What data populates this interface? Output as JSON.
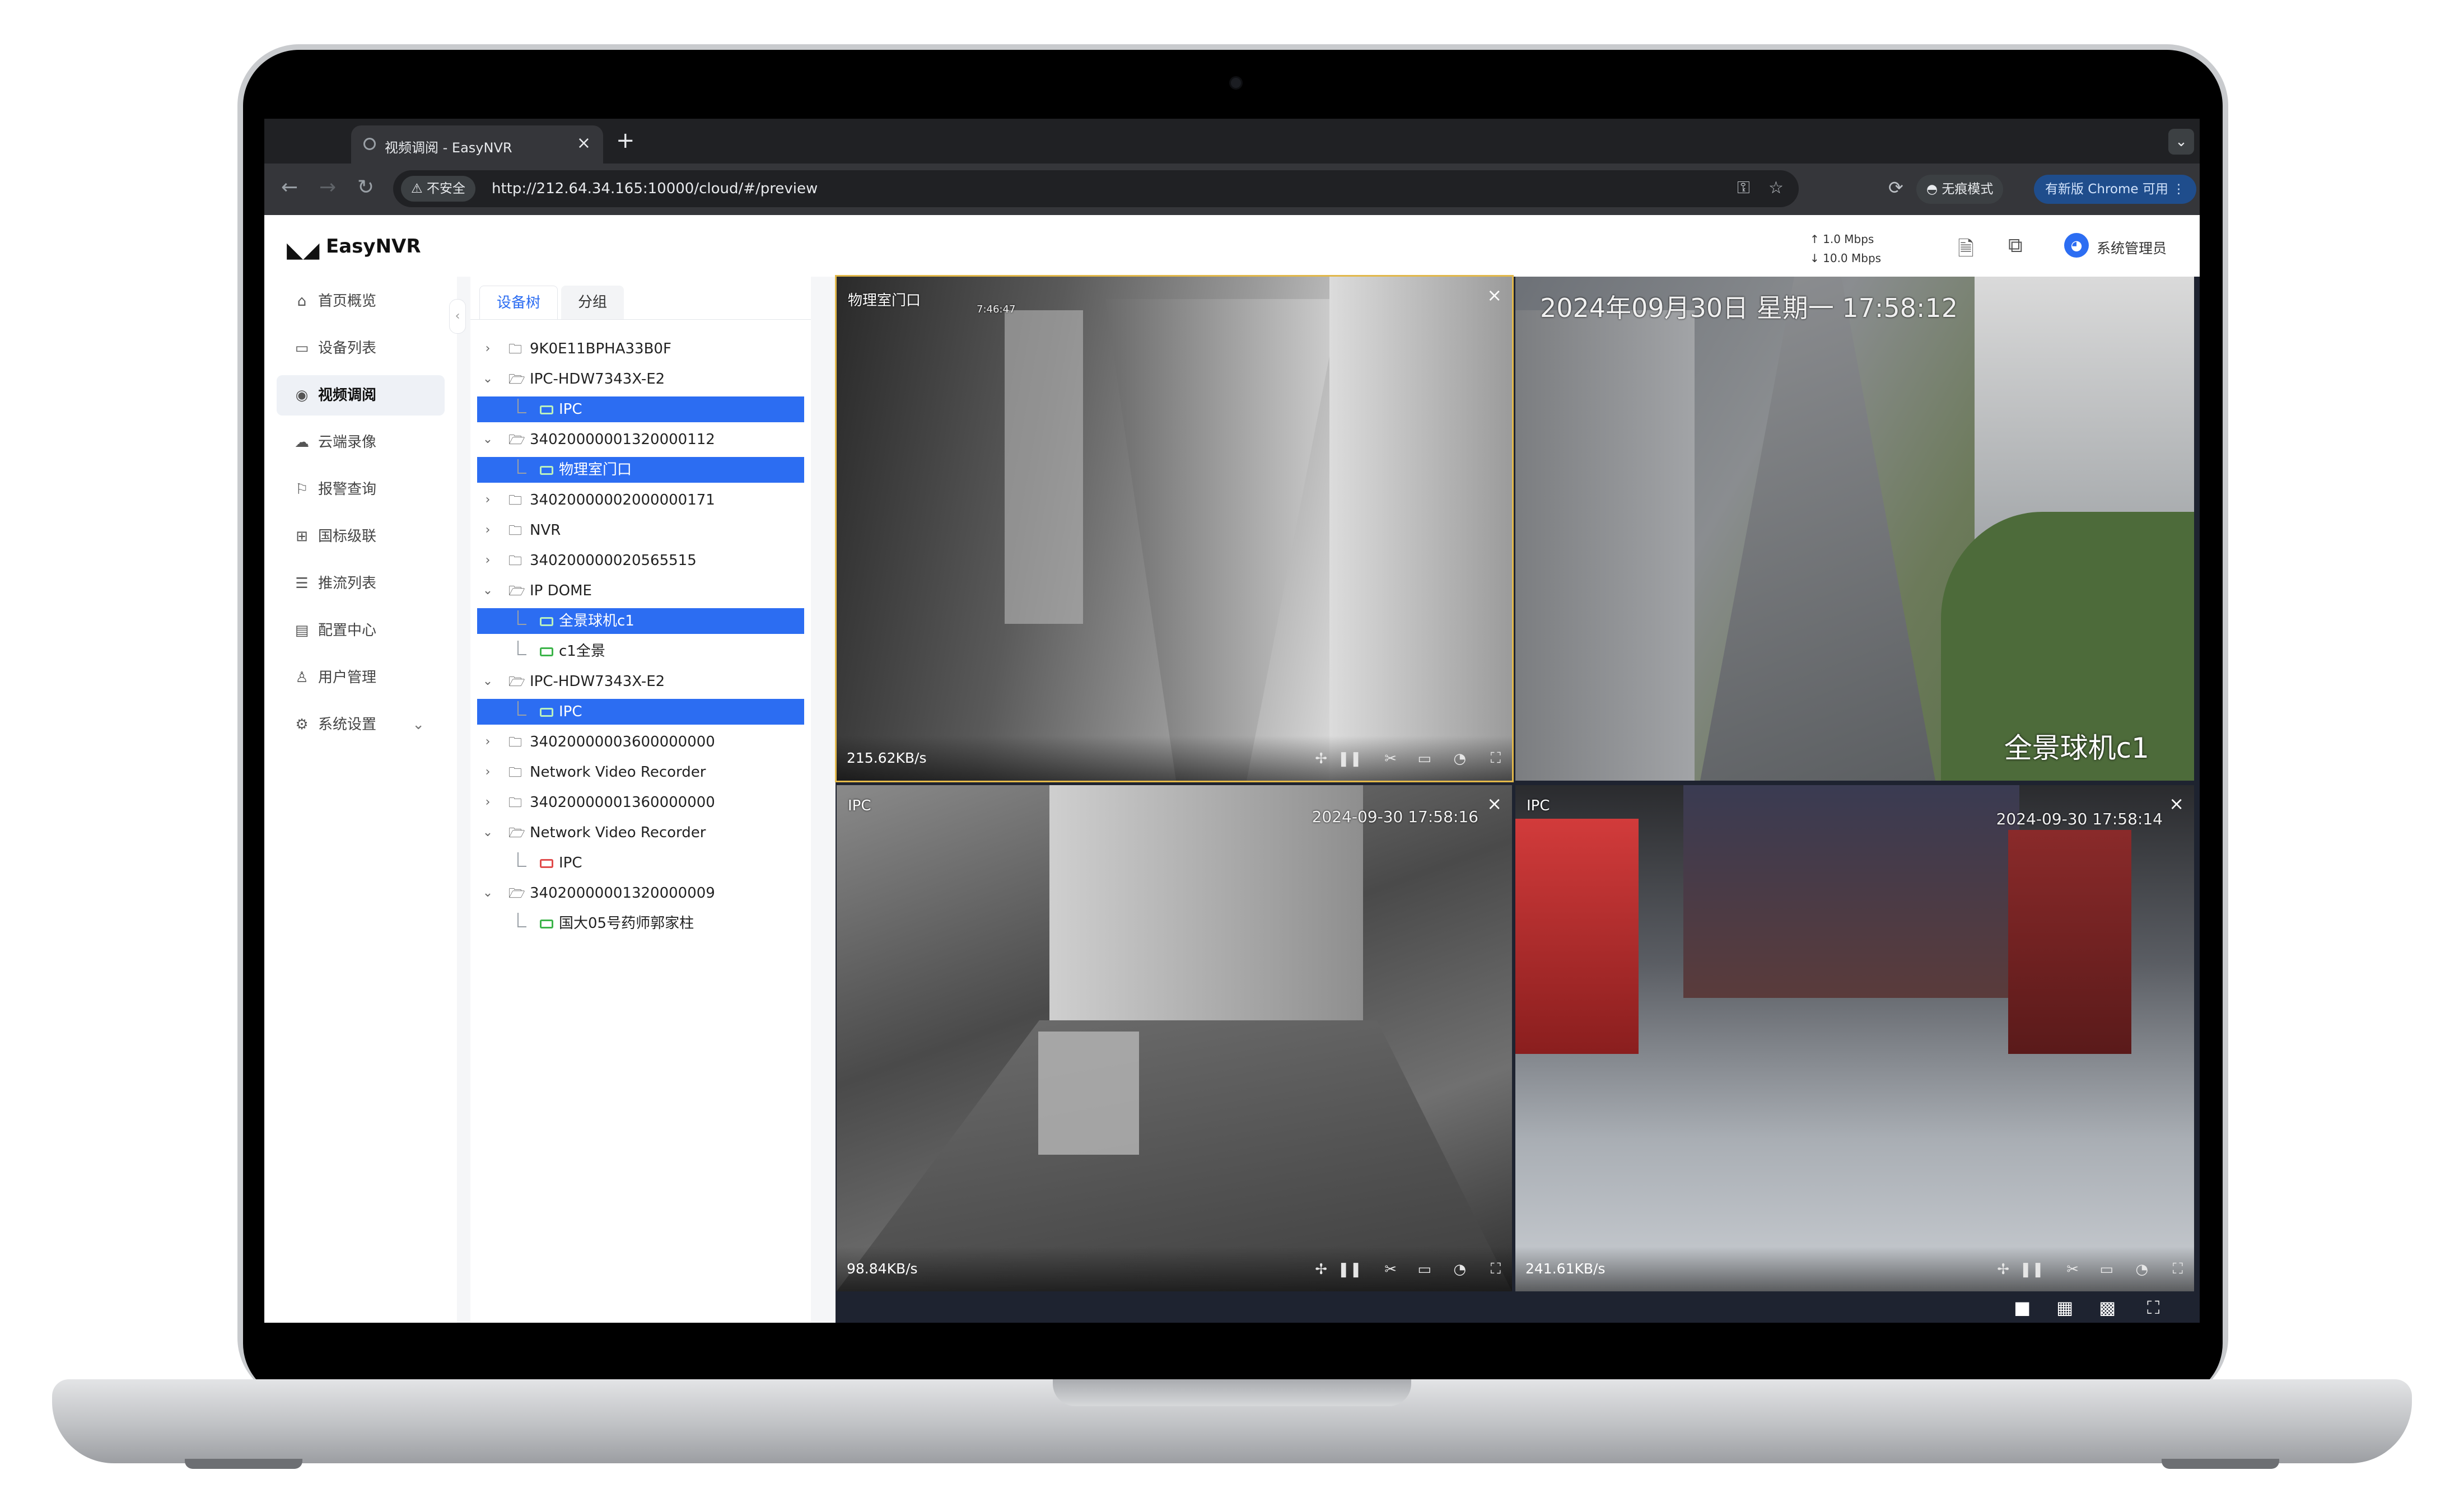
{
  "browser": {
    "tab_title": "视频调阅 - EasyNVR",
    "tab_close": "×",
    "new_tab": "+",
    "tab_menu": "⌄",
    "back": "←",
    "forward": "→",
    "reload": "↻",
    "security_label": "⚠ 不安全",
    "url": "http://212.64.34.165:10000/cloud/#/preview",
    "incognito_label": "无痕模式",
    "update_label": "有新版 Chrome 可用"
  },
  "app": {
    "brand": "EasyNVR",
    "upload_rate": "↑ 1.0 Mbps",
    "download_rate": "↓ 10.0 Mbps",
    "user_name": "系统管理员"
  },
  "sidebar": {
    "items": [
      {
        "label": "首页概览",
        "icon": "⌂"
      },
      {
        "label": "设备列表",
        "icon": "▭"
      },
      {
        "label": "视频调阅",
        "icon": "◉"
      },
      {
        "label": "云端录像",
        "icon": "☁"
      },
      {
        "label": "报警查询",
        "icon": "⚐"
      },
      {
        "label": "国标级联",
        "icon": "⊞"
      },
      {
        "label": "推流列表",
        "icon": "☰"
      },
      {
        "label": "配置中心",
        "icon": "▤"
      },
      {
        "label": "用户管理",
        "icon": "♙"
      },
      {
        "label": "系统设置",
        "icon": "⚙"
      }
    ],
    "settings_chevron": "⌄",
    "collapse_glyph": "‹"
  },
  "tree": {
    "tabs": [
      "设备树",
      "分组"
    ],
    "rows": [
      {
        "label": "9K0E11BPHA33B0F"
      },
      {
        "label": "IPC-HDW7343X-E2"
      },
      {
        "label": "IPC"
      },
      {
        "label": "34020000001320000112"
      },
      {
        "label": "物理室门口"
      },
      {
        "label": "34020000002000000171"
      },
      {
        "label": "NVR"
      },
      {
        "label": "340200000020565515"
      },
      {
        "label": "IP DOME"
      },
      {
        "label": "全景球机c1"
      },
      {
        "label": "c1全景"
      },
      {
        "label": "IPC-HDW7343X-E2"
      },
      {
        "label": "IPC"
      },
      {
        "label": "34020000003600000000"
      },
      {
        "label": "Network Video Recorder"
      },
      {
        "label": "34020000001360000000"
      },
      {
        "label": "Network Video Recorder"
      },
      {
        "label": "IPC"
      },
      {
        "label": "34020000001320000009"
      },
      {
        "label": "国大05号药师郭家柱"
      }
    ]
  },
  "videos": [
    {
      "title": "物理室门口",
      "timestamp": "7:46:47",
      "rate": "215.62KB/s",
      "close": "×"
    },
    {
      "title": "",
      "timestamp": "2024年09月30日 星期一 17:58:12",
      "overlay": "全景球机c1",
      "close": ""
    },
    {
      "title": "IPC",
      "timestamp": "2024-09-30 17:58:16",
      "rate": "98.84KB/s",
      "close": "×"
    },
    {
      "title": "IPC",
      "timestamp": "2024-09-30 17:58:14",
      "rate": "241.61KB/s",
      "close": "×"
    }
  ],
  "controls": {
    "ptz": "✢",
    "pause": "❚❚",
    "cut": "✂",
    "record": "▭",
    "snapshot": "◔",
    "fullscreen": "⛶"
  },
  "layout_icons": {
    "single": "■",
    "quad": "▦",
    "nine": "▩",
    "fullscreen": "⛶"
  }
}
